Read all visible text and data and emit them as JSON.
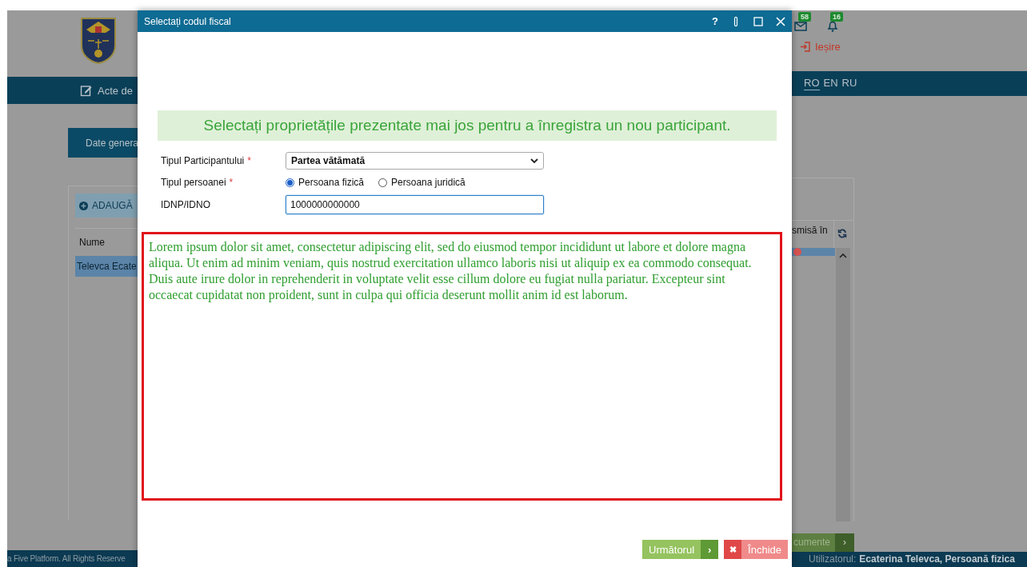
{
  "background_page": {
    "header": {
      "badges": [
        {
          "kind": "mail",
          "count": "58"
        },
        {
          "kind": "bell",
          "count": "16"
        }
      ],
      "logout": "Ieșire"
    },
    "nav": {
      "items": [
        {
          "label": "Acte de"
        }
      ],
      "languages": [
        {
          "label": "RO",
          "selected": true
        },
        {
          "label": "EN",
          "selected": false
        },
        {
          "label": "RU",
          "selected": false
        }
      ]
    },
    "tabs": [
      {
        "label": "Date genera",
        "selected": true
      }
    ],
    "panel": {
      "add_button": "ADAUGĂ",
      "columns": [
        {
          "label": "Nume"
        },
        {
          "label": "smisă în"
        }
      ],
      "rows": [
        {
          "name": "Televca Ecate",
          "color": "#d9534f",
          "selected": true
        }
      ]
    },
    "next_button": "cumente",
    "footer": {
      "copyright": "a Five Platform. All Rights Reserve",
      "user_label": "Utilizatorul:",
      "user": "Ecaterina Televca, Persoană fizica"
    }
  },
  "dialog": {
    "title": "Selectați codul fiscal",
    "help": "?",
    "banner": "Selectați proprietățile prezentate mai jos pentru a înregistra un nou participant.",
    "fields": [
      {
        "kind": "select",
        "label": "Tipul Participantului",
        "required_mark": "*",
        "value": "Partea vătămată"
      },
      {
        "kind": "radio",
        "label": "Tipul persoanei",
        "required_mark": "*",
        "options": [
          {
            "label": "Persoana fizică",
            "selected": true
          },
          {
            "label": "Persoana juridică",
            "selected": false
          }
        ]
      },
      {
        "kind": "text",
        "label": "IDNP/IDNO",
        "value": "1000000000000"
      }
    ],
    "notice": "Lorem ipsum dolor sit amet, consectetur adipiscing elit, sed do eiusmod tempor incididunt ut labore et dolore magna aliqua. Ut enim ad minim veniam, quis nostrud exercitation ullamco laboris nisi ut aliquip ex ea commodo consequat. Duis aute irure dolor in reprehenderit in voluptate velit esse cillum dolore eu fugiat nulla pariatur. Excepteur sint occaecat cupidatat non proident, sunt in culpa qui officia deserunt mollit anim id est laborum.",
    "buttons": [
      {
        "kind": "next",
        "label": "Următorul",
        "icon": "›"
      },
      {
        "kind": "close",
        "label": "Închide",
        "icon": "✖"
      }
    ]
  }
}
